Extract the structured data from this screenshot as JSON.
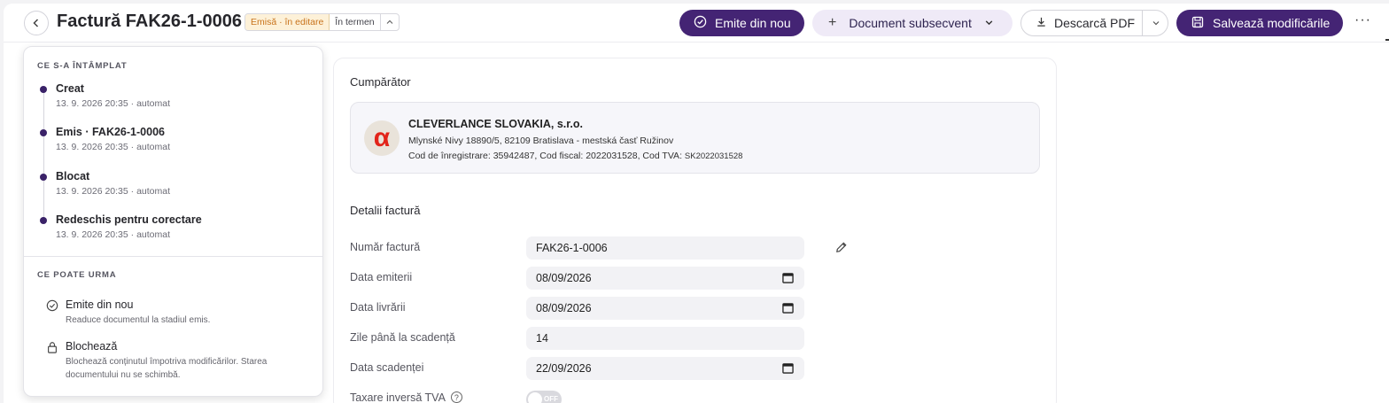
{
  "header": {
    "title": "Factură FAK26-1-0006",
    "status_badge": "Emisă · în editare",
    "term_badge": "În termen",
    "reissue_label": "Emite din nou",
    "subsequent_label": "Document subsecvent",
    "download_label": "Descarcă PDF",
    "save_label": "Salvează modificările"
  },
  "history": {
    "happened_title": "CE S-A ÎNTÂMPLAT",
    "events": [
      {
        "label": "Creat",
        "meta": "13. 9. 2026 20:35 · automat"
      },
      {
        "label": "Emis · FAK26-1-0006",
        "meta": "13. 9. 2026 20:35 · automat"
      },
      {
        "label": "Blocat",
        "meta": "13. 9. 2026 20:35 · automat"
      },
      {
        "label": "Redeschis pentru corectare",
        "meta": "13. 9. 2026 20:35 · automat"
      }
    ],
    "next_title": "CE POATE URMA",
    "next_actions": [
      {
        "label": "Emite din nou",
        "desc": "Readuce documentul la stadiul emis.",
        "icon": "check-circle-icon"
      },
      {
        "label": "Blochează",
        "desc": "Blochează conținutul împotriva modificărilor. Starea documentului nu se schimbă.",
        "icon": "lock-icon"
      }
    ]
  },
  "buyer": {
    "heading": "Cumpărător",
    "logo_letter": "α",
    "name": "CLEVERLANCE SLOVAKIA, s.r.o.",
    "address": "Mlynské Nivy 18890/5, 82109 Bratislava - mestská časť Ružinov",
    "ids_prefix": "Cod de înregistrare: 35942487, Cod fiscal: 2022031528, Cod TVA: ",
    "vat_id": "SK2022031528"
  },
  "details": {
    "heading": "Detalii factură",
    "fields": [
      {
        "label": "Număr factură",
        "value": "FAK26-1-0006"
      },
      {
        "label": "Data emiterii",
        "value": "08/09/2026"
      },
      {
        "label": "Data livrării",
        "value": "08/09/2026"
      },
      {
        "label": "Zile până la scadență",
        "value": "14"
      },
      {
        "label": "Data scadenței",
        "value": "22/09/2026"
      }
    ],
    "reverse_charge_label": "Taxare inversă TVA",
    "reverse_charge_state": "OFF"
  }
}
